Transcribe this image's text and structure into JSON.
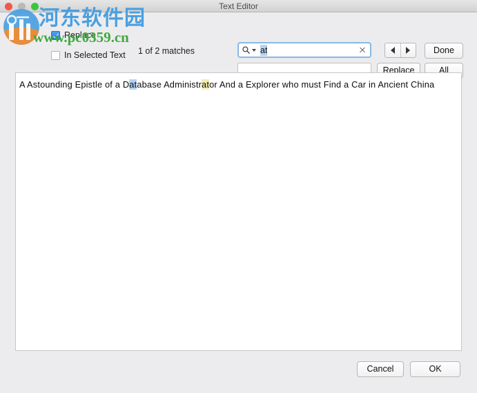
{
  "window": {
    "title": "Text Editor",
    "traffic_lights": [
      {
        "name": "close",
        "color": "#f3584a"
      },
      {
        "name": "minimize",
        "color": "#b9b9b9"
      },
      {
        "name": "zoom",
        "color": "#3cc53c"
      }
    ]
  },
  "find_bar": {
    "replace_checkbox": {
      "label": "Replace",
      "checked": true
    },
    "in_selected_text_checkbox": {
      "label": "In Selected Text",
      "checked": false
    },
    "match_status": "1 of 2 matches",
    "search_field": {
      "value": "at",
      "placeholder": "",
      "icon": "search-icon",
      "dropdown_icon": "chevron-down-icon",
      "clear_icon": "close-icon",
      "selected": true
    },
    "replace_field": {
      "value": "",
      "placeholder": ""
    },
    "nav": {
      "previous_icon": "triangle-left-icon",
      "next_icon": "triangle-right-icon"
    },
    "buttons": {
      "done": "Done",
      "replace": "Replace",
      "all": "All"
    }
  },
  "editor": {
    "line_segments": [
      {
        "text": "A Astounding Epistle of a D",
        "highlight": "none"
      },
      {
        "text": "at",
        "highlight": "current"
      },
      {
        "text": "abase Administr",
        "highlight": "none"
      },
      {
        "text": "at",
        "highlight": "other"
      },
      {
        "text": "or And a Explorer who must Find a Car in Ancient China",
        "highlight": "none"
      }
    ],
    "full_text": "A Astounding Epistle of a Database Administrator And a Explorer who must Find a Car in Ancient China"
  },
  "footer": {
    "cancel": "Cancel",
    "ok": "OK"
  },
  "watermark": {
    "chinese_text": "河东软件园",
    "url_text": "www.pc0359.cn",
    "logo": "site-logo-icon",
    "chinese_color": "#4a9fe0",
    "url_color": "#3fa93f"
  },
  "colors": {
    "window_background": "#ececee",
    "current_match_highlight": "#b4d3f2",
    "other_match_highlight": "#f1edb3",
    "focus_ring": "#86b8e8"
  }
}
